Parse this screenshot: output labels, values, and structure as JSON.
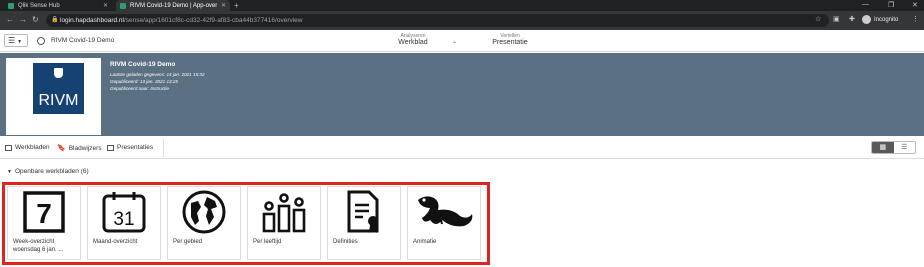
{
  "browser": {
    "tabs": [
      {
        "label": "Qlik Sense Hub",
        "active": false
      },
      {
        "label": "RIVM Covid-19 Demo | App-over",
        "active": true
      }
    ],
    "url_host": "login.hapdashboard.nl",
    "url_path": "/sense/app/1601cf8c-cd32-42f9-af83-cba44b377416/overview",
    "profile_label": "Incognito"
  },
  "header": {
    "menu_icon": "hamburger-icon",
    "app_title": "RIVM Covid-19 Demo",
    "mode_analyze_label": "Analyseren",
    "mode_analyze_value": "Werkblad",
    "mode_tell_label": "Vertellen",
    "mode_tell_value": "Presentatie"
  },
  "banner": {
    "logo_text": "RIVM",
    "title": "RIVM Covid-19 Demo",
    "last_loaded": "Laatste geladen gegevens: 14 jan. 2021 15:32",
    "published": "Gepubliceerd: 13 jan. 2021 13:25",
    "published_to": "Gepubliceerd naar: Instructie",
    "accent": "#5b7083"
  },
  "toolbar": {
    "tabs": [
      "Werkbladen",
      "Bladwijzers",
      "Presentaties"
    ]
  },
  "section_title": "Openbare werkbladen (6)",
  "sheets": [
    {
      "icon": "calendar-7-icon",
      "label": "Week-overzicht",
      "sub": "woensdag 6 jan. ..."
    },
    {
      "icon": "calendar-31-icon",
      "label": "Maand-overzicht"
    },
    {
      "icon": "globe-icon",
      "label": "Per gebied"
    },
    {
      "icon": "people-bars-icon",
      "label": "Per leeftijd"
    },
    {
      "icon": "certificate-icon",
      "label": "Definities"
    },
    {
      "icon": "lizard-icon",
      "label": "Animatie"
    }
  ],
  "highlight_color": "#e0231f"
}
